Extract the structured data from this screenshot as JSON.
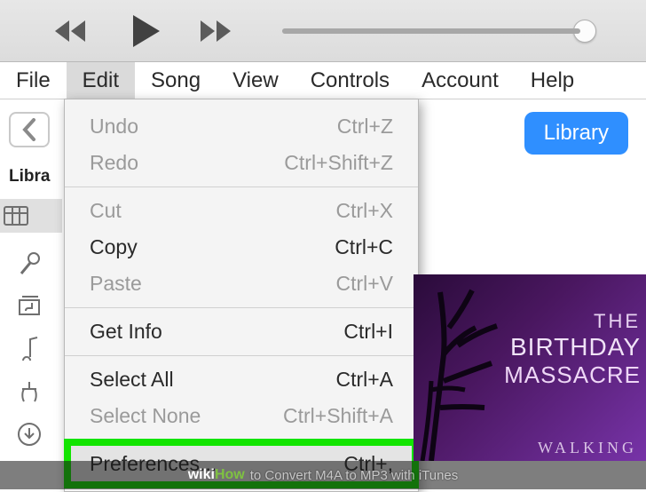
{
  "menubar": {
    "file": "File",
    "edit": "Edit",
    "song": "Song",
    "view": "View",
    "controls": "Controls",
    "account": "Account",
    "help": "Help"
  },
  "library_button": "Library",
  "sidebar": {
    "heading": "Libra"
  },
  "edit_menu": {
    "undo": {
      "label": "Undo",
      "accel": "Ctrl+Z"
    },
    "redo": {
      "label": "Redo",
      "accel": "Ctrl+Shift+Z"
    },
    "cut": {
      "label": "Cut",
      "accel": "Ctrl+X"
    },
    "copy": {
      "label": "Copy",
      "accel": "Ctrl+C"
    },
    "paste": {
      "label": "Paste",
      "accel": "Ctrl+V"
    },
    "getinfo": {
      "label": "Get Info",
      "accel": "Ctrl+I"
    },
    "selectall": {
      "label": "Select All",
      "accel": "Ctrl+A"
    },
    "selectnone": {
      "label": "Select None",
      "accel": "Ctrl+Shift+A"
    },
    "preferences": {
      "label": "Preferences...",
      "accel": "Ctrl+,"
    }
  },
  "album": {
    "line1": "THE",
    "line2": "BIRTHDAY",
    "line3": "MASSACRE",
    "sub": "WALKING"
  },
  "caption": {
    "brand_w": "wiki",
    "brand_h": "How",
    "text": "to Convert M4A to MP3 with iTunes"
  }
}
